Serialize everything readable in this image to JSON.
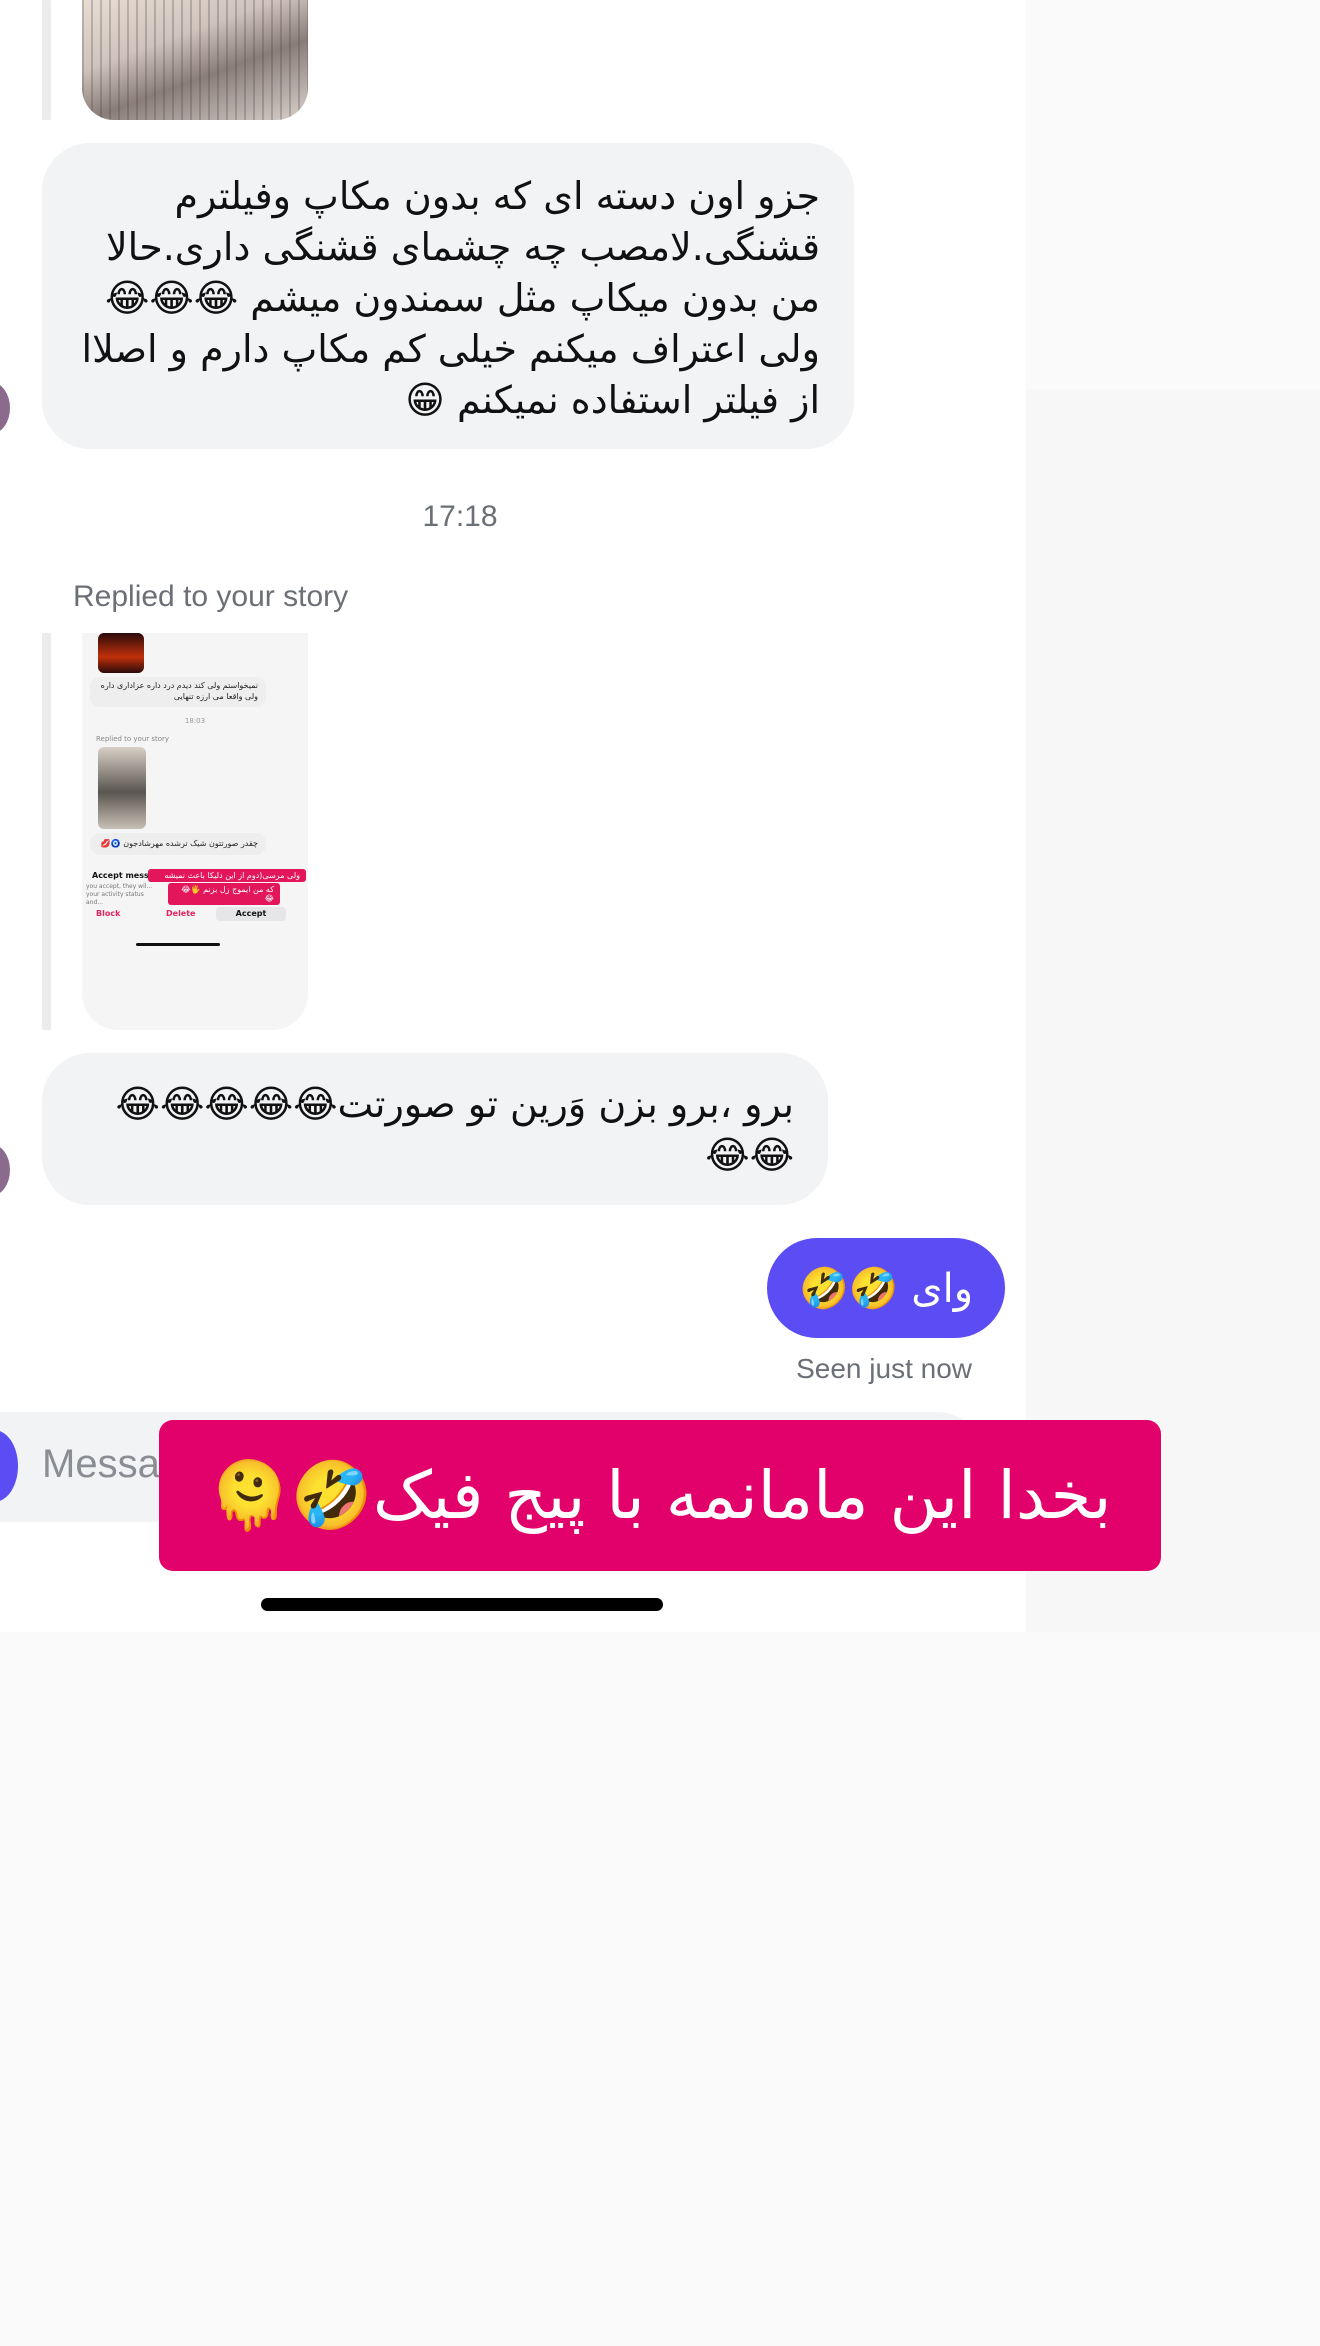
{
  "messages": {
    "received_1": "جزو اون دسته ای که بدون مکاپ وفیلترم قشنگی.لامصب چه چشمای قشنگی داری.حالا من بدون میکاپ مثل سمندون میشم 😂😂😂 ولی اعتراف میکنم خیلی کم مکاپ دارم و اصلاا از فیلتر استفاده نمیکنم 😁",
    "timestamp": "17:18",
    "story_reply_label": "Replied to your story",
    "received_2": "برو ،برو بزن وَرین تو صورتت😂😂😂😂😂😂😂",
    "sent": "وای 🤣🤣",
    "seen_status": "Seen just now"
  },
  "story_thumbnail": {
    "bubble_1": "نمیخواستم ولی کند دیدم درد داره عزاداری داره ولی واقعا می ارزه تنهایی",
    "time": "18:03",
    "replied_label": "Replied to your story",
    "bubble_2": "چقدر صورتتون شیک ترشده مهرشادجون 🧿💋",
    "accept_title": "Accept message",
    "accept_body": "you accept, they wil... your activity status and...",
    "banner_1": "ولی مرسی(دوم از این دلیکا باعث نمیشه",
    "banner_2": "که من ایموج زل بزنم 🖐😂😂",
    "block": "Block",
    "delete": "Delete",
    "accept": "Accept"
  },
  "composer": {
    "placeholder": "Messa"
  },
  "overlay_caption": "بخدا این مامانمه با پیج فیک🤣🫠",
  "colors": {
    "sent_bubble": "#5b4cf4",
    "received_bubble": "#f2f3f5",
    "overlay": "#e2006a"
  }
}
